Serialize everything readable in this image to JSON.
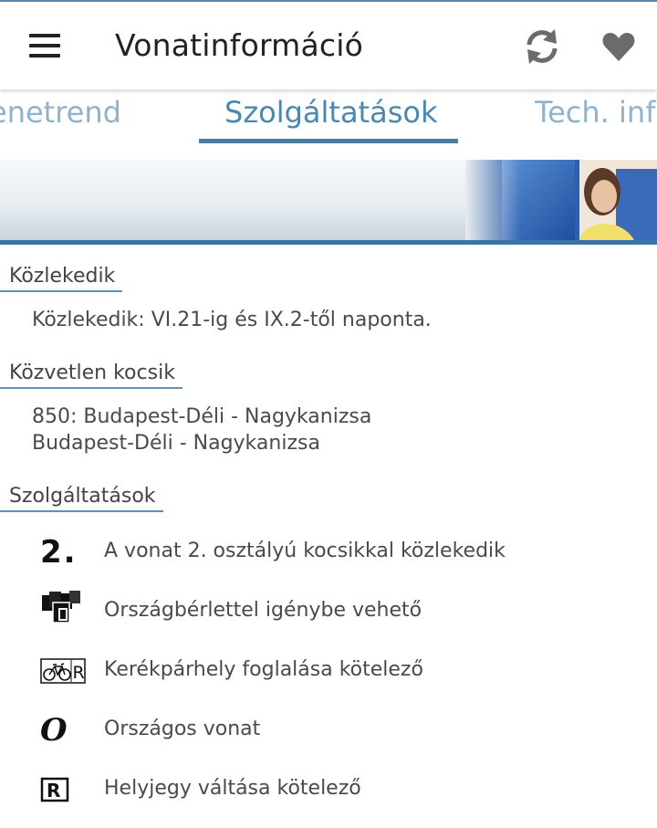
{
  "app": {
    "title": "Vonatinformáció",
    "icons": {
      "menu": "hamburger-menu-icon",
      "refresh": "refresh-icon",
      "favorite": "heart-icon"
    }
  },
  "tabs": [
    {
      "label": "Menetrend",
      "visible_text": "enetrend",
      "active": false
    },
    {
      "label": "Szolgáltatások",
      "visible_text": "Szolgáltatások",
      "active": true
    },
    {
      "label": "Tech. info",
      "visible_text": "Tech. info",
      "active": false
    }
  ],
  "colors": {
    "accent": "#4a7fa3",
    "tab_active": "#4a88ad",
    "tab_inactive": "#8fb3cc",
    "banner_line": "#3d73a6"
  },
  "sections": {
    "kozlekedik": {
      "heading": "Közlekedik",
      "text": "Közlekedik: VI.21-ig és IX.2-től naponta."
    },
    "kozvetlen": {
      "heading": "Közvetlen kocsik",
      "lines": [
        "850: Budapest-Déli - Nagykanizsa",
        "Budapest-Déli - Nagykanizsa"
      ]
    },
    "szolgaltatasok": {
      "heading": "Szolgáltatások",
      "items": [
        {
          "icon": "second-class-icon",
          "icon_text": "2.",
          "label": "A vonat 2. osztályú kocsikkal közlekedik"
        },
        {
          "icon": "national-pass-icon",
          "icon_text": "",
          "label": "Országbérlettel igénybe vehető"
        },
        {
          "icon": "bicycle-reservation-icon",
          "icon_text": "R",
          "label": "Kerékpárhely foglalása kötelező"
        },
        {
          "icon": "national-train-icon",
          "icon_text": "O",
          "label": "Országos vonat"
        },
        {
          "icon": "seat-reservation-icon",
          "icon_text": "R",
          "label": "Helyjegy váltása kötelező"
        }
      ]
    }
  }
}
